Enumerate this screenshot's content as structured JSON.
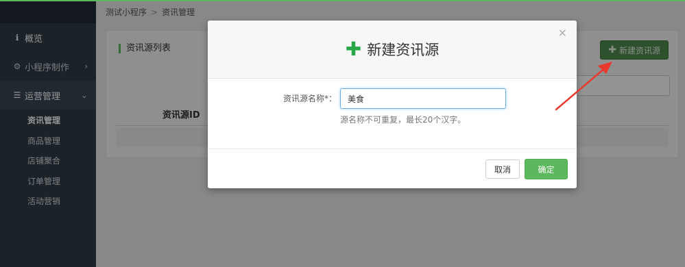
{
  "breadcrumb": {
    "app": "测试小程序",
    "separator": ">",
    "page": "资讯管理"
  },
  "sidebar": {
    "items": [
      {
        "label": "概览",
        "icon": "info-icon",
        "glyph": "ℹ"
      },
      {
        "label": "小程序制作",
        "icon": "gear-icon",
        "glyph": "⚙",
        "chevron": "›"
      },
      {
        "label": "运营管理",
        "icon": "server-icon",
        "glyph": "☰",
        "chevron": "⌄"
      }
    ],
    "subitems": [
      {
        "label": "资讯管理"
      },
      {
        "label": "商品管理"
      },
      {
        "label": "店铺聚合"
      },
      {
        "label": "订单管理"
      },
      {
        "label": "活动营销"
      }
    ]
  },
  "panel": {
    "title": "资讯源列表",
    "new_button": "新建资讯源",
    "column_header": "资讯源ID"
  },
  "modal": {
    "title": "新建资讯源",
    "close": "×",
    "field_label": "资讯源名称*：",
    "field_value": "美食",
    "help_text": "源名称不可重复，最长20个汉字。",
    "cancel_label": "取消",
    "confirm_label": "确定"
  },
  "colors": {
    "accent_green": "#5cb85c",
    "sidebar_bg": "#2f3b45",
    "arrow_red": "#e8392f"
  }
}
